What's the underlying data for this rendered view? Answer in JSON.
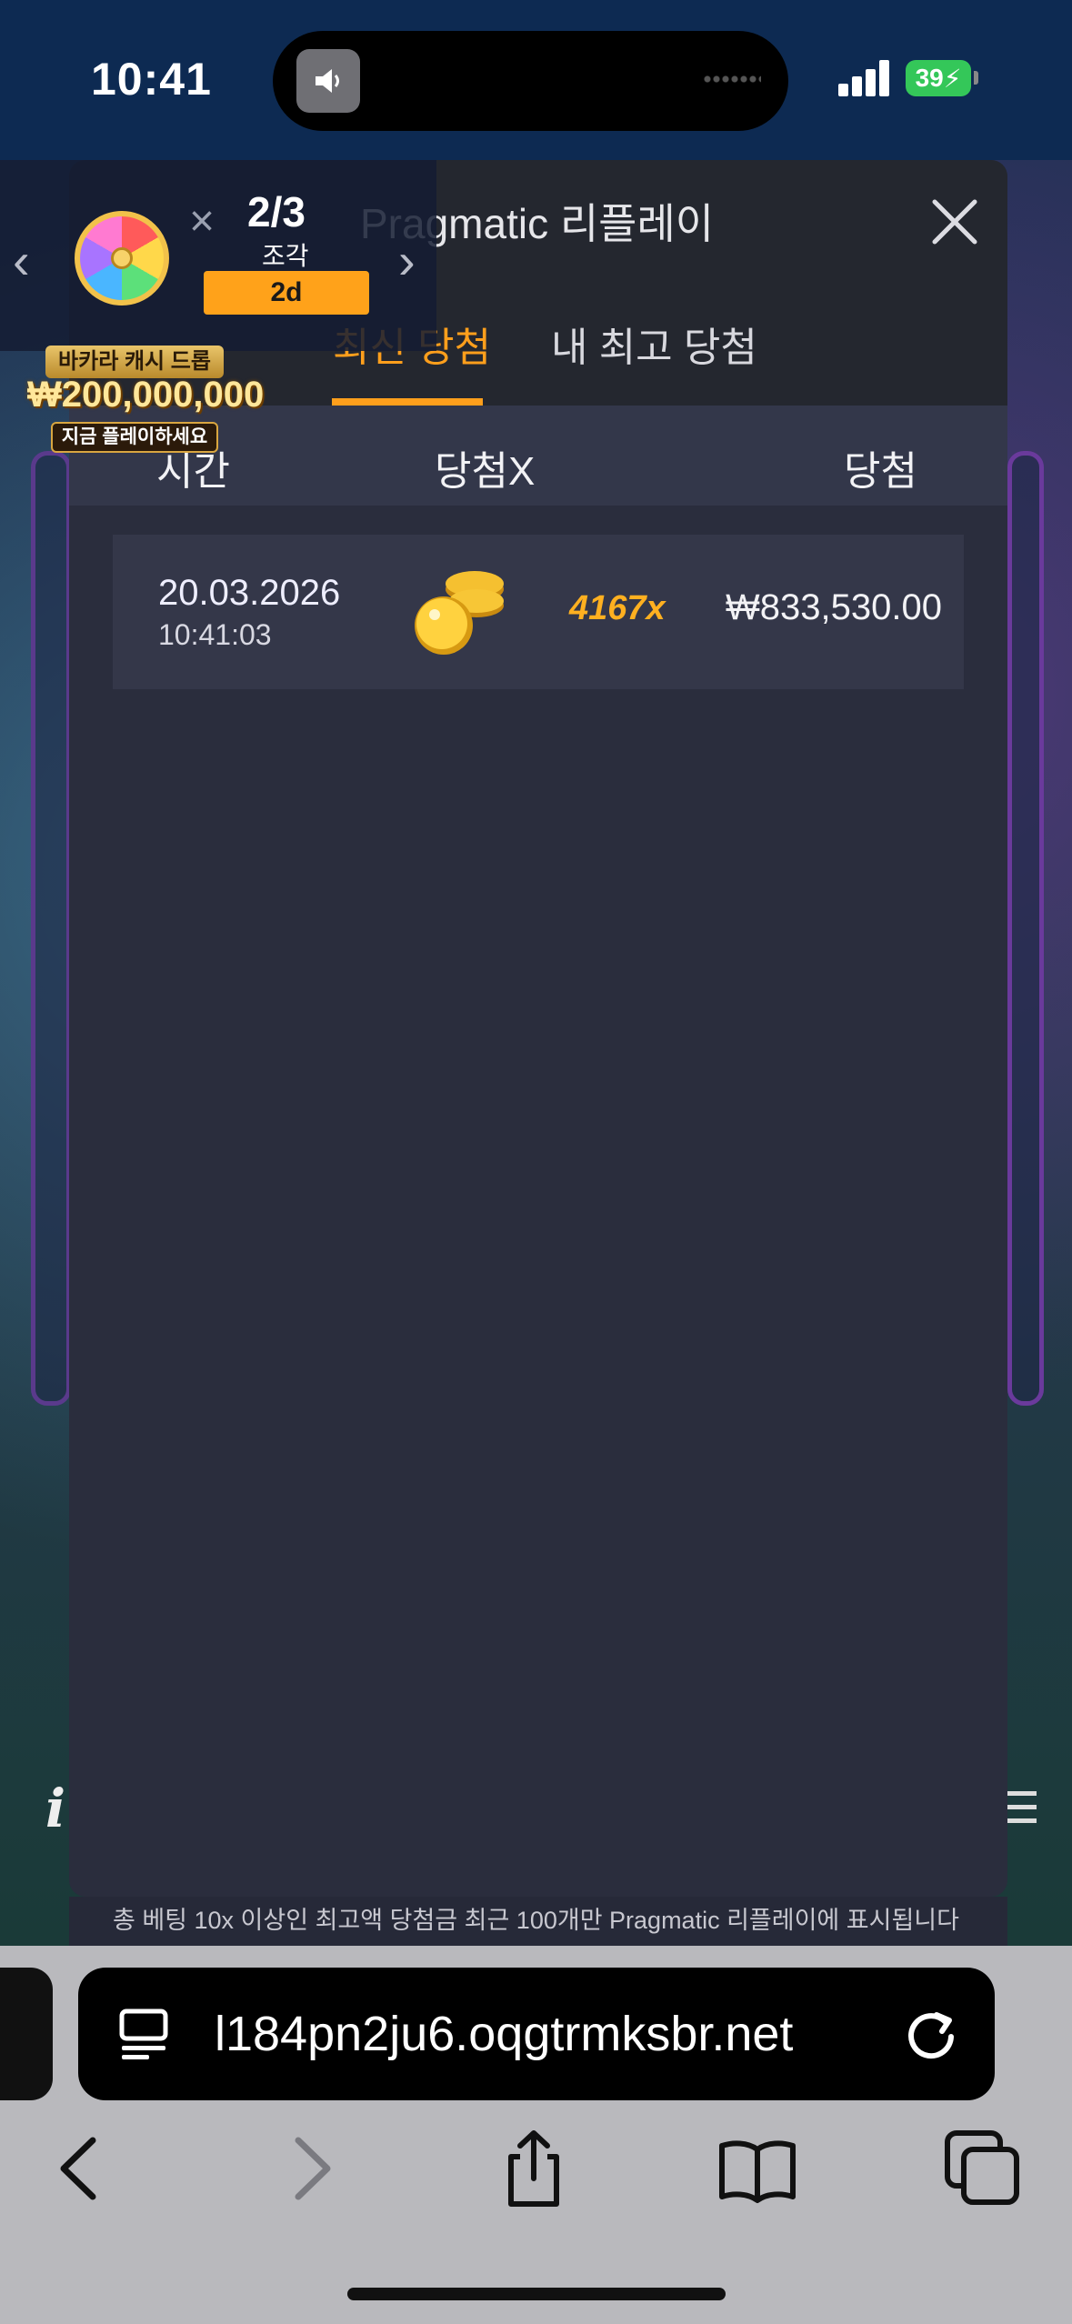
{
  "status_bar": {
    "time": "10:41",
    "battery": "39"
  },
  "promo": {
    "count": "2/3",
    "pieces_label": "조각",
    "badge": "2d",
    "drop_name": "바카라 캐시 드롭",
    "drop_amount": "₩200,000,000",
    "drop_cta": "지금 플레이하세요"
  },
  "panel": {
    "title": "Pragmatic 리플레이",
    "tabs": [
      "최신 당첨",
      "내 최고 당첨"
    ],
    "active_tab": "최신 당첨",
    "columns": [
      "시간",
      "당첨X",
      "당첨"
    ],
    "rows": [
      {
        "date": "20.03.2026",
        "time": "10:41:03",
        "icon": "coin-stack",
        "multiplier": "4167x",
        "win": "₩833,530.00"
      }
    ],
    "footnote": "총 베팅 10x 이상인 최고액 당첨금 최근 100개만 Pragmatic 리플레이에 표시됩니다"
  },
  "browser": {
    "url": "l184pn2ju6.oqgtrmksbr.net",
    "buttons": [
      "back",
      "forward",
      "share",
      "bookmarks",
      "tabs"
    ]
  },
  "colors": {
    "accent": "#ff9f1c",
    "panel_bg": "#2a2d3d",
    "header_bg": "#24272f",
    "row_bg": "#343749",
    "battery": "#34c759"
  }
}
